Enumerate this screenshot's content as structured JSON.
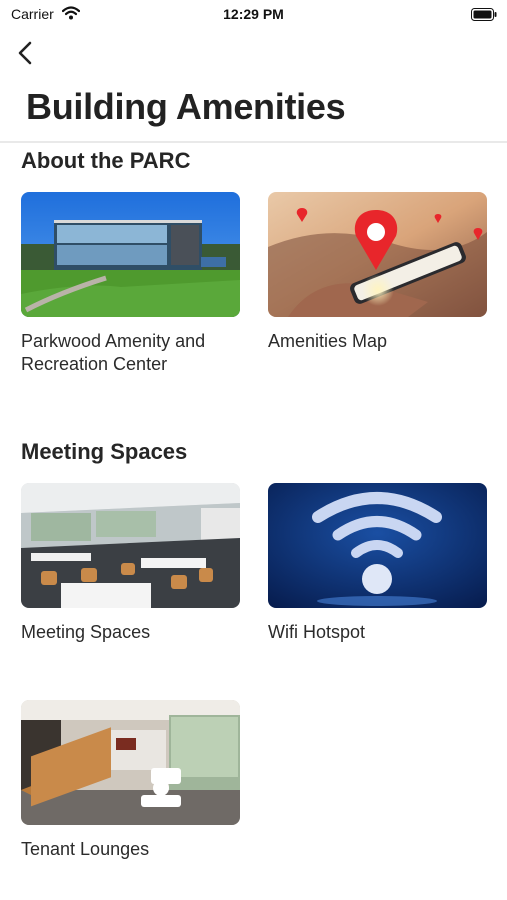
{
  "status_bar": {
    "carrier": "Carrier",
    "time": "12:29 PM"
  },
  "nav": {
    "back_icon": "chevron-left-icon"
  },
  "page": {
    "title": "Building Amenities"
  },
  "sections": [
    {
      "title": "About the PARC",
      "items": [
        {
          "label": "Parkwood Amenity and Recreation Center",
          "image": "modern-glass-building-photo"
        },
        {
          "label": "Amenities Map",
          "image": "phone-map-pin-photo"
        }
      ]
    },
    {
      "title": "Meeting Spaces",
      "items": [
        {
          "label": "Meeting Spaces",
          "image": "conference-room-photo"
        },
        {
          "label": "Wifi Hotspot",
          "image": "wifi-signal-graphic"
        },
        {
          "label": "Tenant Lounges",
          "image": "lounge-interior-photo"
        }
      ]
    }
  ],
  "colors": {
    "pin": "#e8262b",
    "wifi_bg": "#0a2a66",
    "sky": "#2f7fe0",
    "grass": "#4f9a2e"
  }
}
